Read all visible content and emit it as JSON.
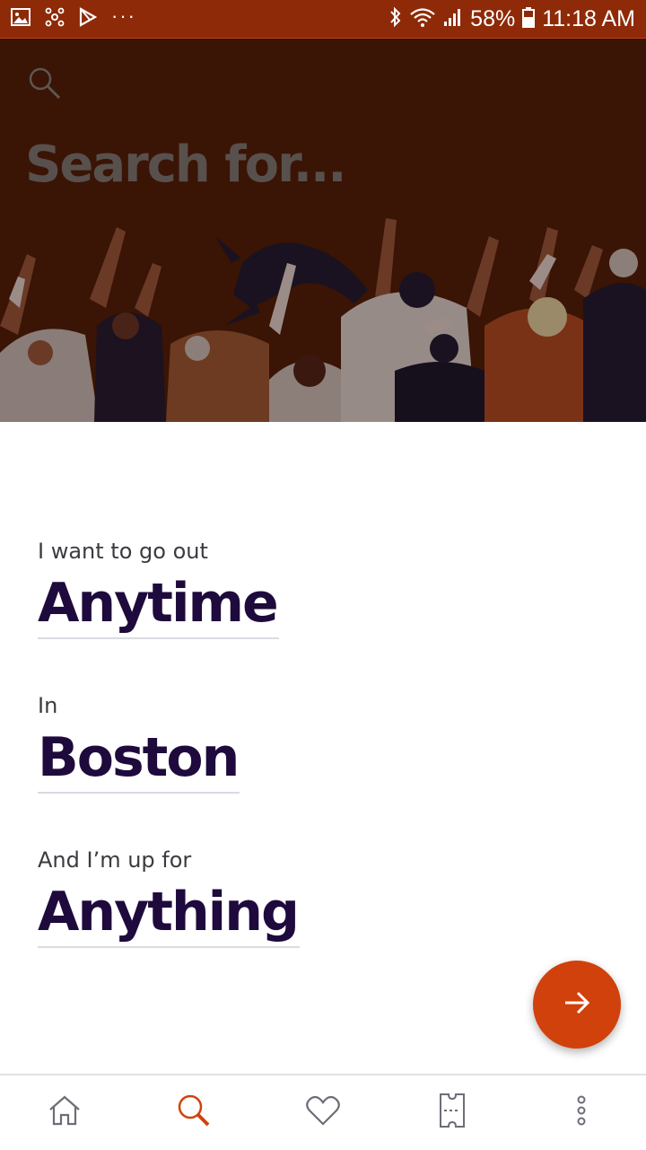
{
  "status_bar": {
    "battery": "58%",
    "time": "11:18 AM",
    "icons": [
      "gallery-icon",
      "network-icon",
      "play-store-icon",
      "more-notifications-icon",
      "bluetooth-icon",
      "wifi-icon",
      "signal-icon",
      "battery-icon"
    ]
  },
  "hero": {
    "title": "Search for...",
    "search_icon": "search-icon"
  },
  "filters": {
    "when": {
      "prompt": "I want to go out",
      "value": "Anytime"
    },
    "where": {
      "prompt": "In",
      "value": "Boston"
    },
    "what": {
      "prompt": "And I’m up for",
      "value": "Anything"
    }
  },
  "fab": {
    "icon": "arrow-right-icon"
  },
  "bottom_nav": {
    "items": [
      {
        "name": "home",
        "icon": "home-icon",
        "active": false
      },
      {
        "name": "search",
        "icon": "search-icon",
        "active": true
      },
      {
        "name": "likes",
        "icon": "heart-icon",
        "active": false
      },
      {
        "name": "tickets",
        "icon": "ticket-icon",
        "active": false
      },
      {
        "name": "more",
        "icon": "more-vertical-icon",
        "active": false
      }
    ]
  },
  "colors": {
    "accent": "#d1410c",
    "status_bar": "#8e2a07",
    "hero_bg": "#3a1405",
    "heading_text": "#1e0a3c",
    "nav_icon": "#6f6c78"
  }
}
